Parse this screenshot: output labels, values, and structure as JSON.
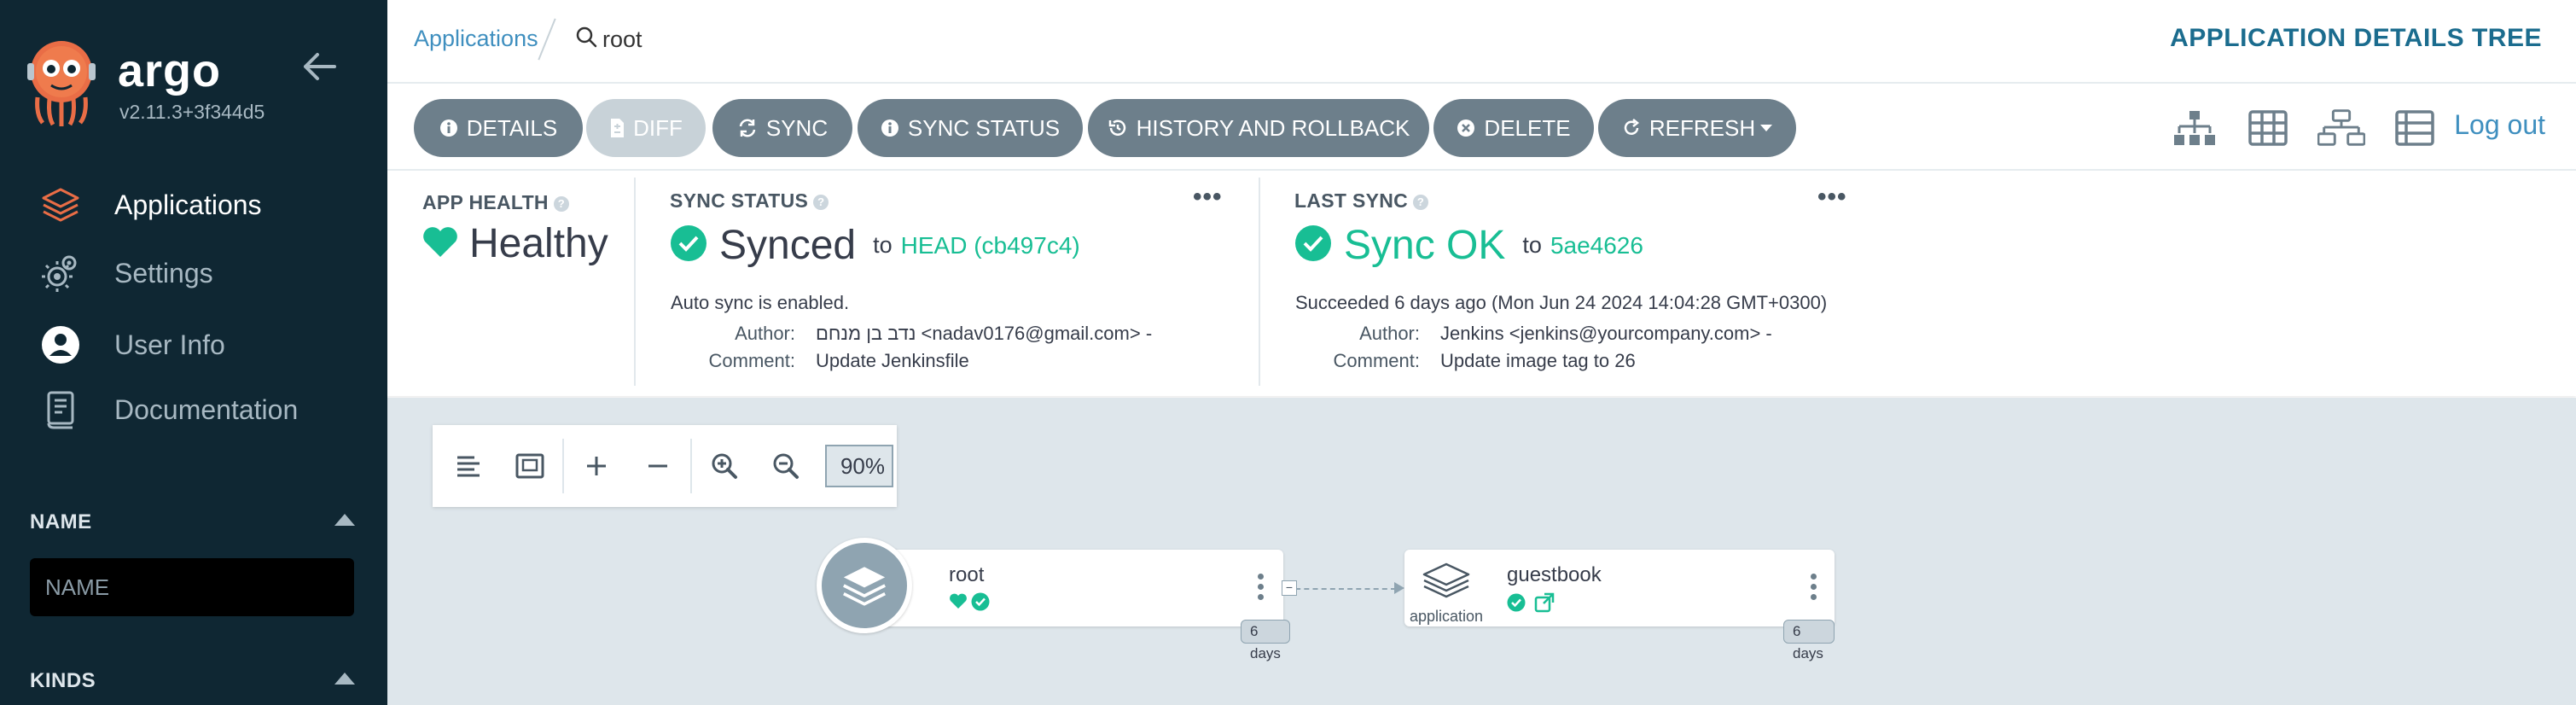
{
  "sidebar": {
    "brand": "argo",
    "version": "v2.11.3+3f344d5",
    "nav": [
      {
        "label": "Applications",
        "icon": "layers-icon",
        "active": true
      },
      {
        "label": "Settings",
        "icon": "gears-icon",
        "active": false
      },
      {
        "label": "User Info",
        "icon": "user-circle-icon",
        "active": false
      },
      {
        "label": "Documentation",
        "icon": "book-icon",
        "active": false
      }
    ],
    "filters": {
      "name_title": "NAME",
      "name_placeholder": "NAME",
      "kinds_title": "KINDS"
    }
  },
  "topbar": {
    "breadcrumb_apps": "Applications",
    "breadcrumb_current": "root",
    "page_title": "APPLICATION DETAILS TREE"
  },
  "toolbar": {
    "details": "DETAILS",
    "diff": "DIFF",
    "sync": "SYNC",
    "sync_status": "SYNC STATUS",
    "history": "HISTORY AND ROLLBACK",
    "delete": "DELETE",
    "refresh": "REFRESH",
    "logout": "Log out",
    "view_icons": [
      "sitemap-icon",
      "grid-icon",
      "network-icon",
      "list-icon"
    ]
  },
  "status": {
    "health": {
      "label": "APP HEALTH",
      "value": "Healthy",
      "color": "#18be94"
    },
    "sync": {
      "label": "SYNC STATUS",
      "value": "Synced",
      "to": "to",
      "revision": "HEAD (cb497c4)",
      "auto": "Auto sync is enabled.",
      "author_key": "Author:",
      "author_value": "נדב בן מנחם <nadav0176@gmail.com> -",
      "comment_key": "Comment:",
      "comment_value": "Update Jenkinsfile"
    },
    "last_sync": {
      "label": "LAST SYNC",
      "value": "Sync OK",
      "to": "to",
      "revision": "5ae4626",
      "succeeded": "Succeeded 6 days ago (Mon Jun 24 2024 14:04:28 GMT+0300)",
      "author_key": "Author:",
      "author_value": "Jenkins <jenkins@yourcompany.com> -",
      "comment_key": "Comment:",
      "comment_value": "Update image tag to 26"
    }
  },
  "graph": {
    "zoom": "90%",
    "nodes": [
      {
        "name": "root",
        "kind": "",
        "age": "6 days"
      },
      {
        "name": "guestbook",
        "kind": "application",
        "age": "6 days"
      }
    ]
  },
  "colors": {
    "sidebar_bg": "#0f2733",
    "accent_green": "#18be94",
    "button_gray": "#6d7f8b",
    "link_blue": "#3f8fbf",
    "graph_bg": "#dee6eb"
  }
}
